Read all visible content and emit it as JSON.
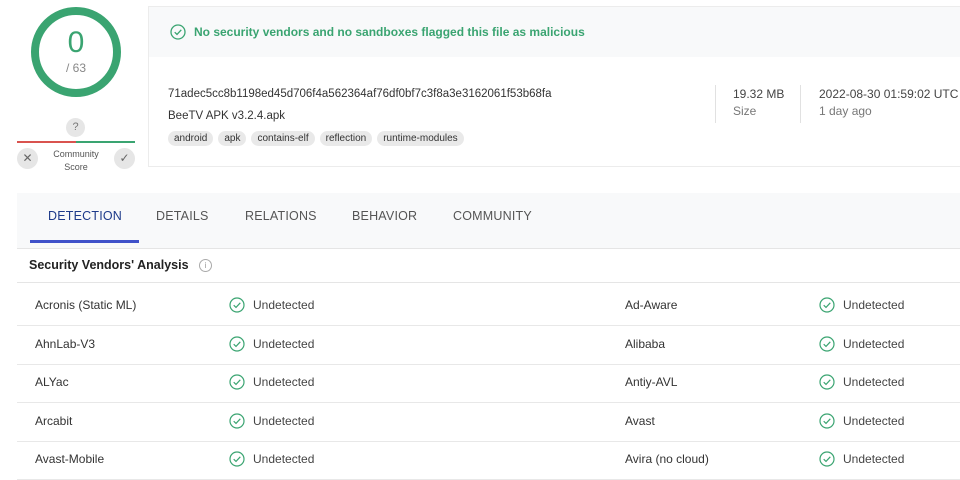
{
  "score": {
    "detections": "0",
    "total": "/ 63",
    "fraction": 0.0,
    "color": "#3aa471"
  },
  "community": {
    "question": "?",
    "label_line1": "Community",
    "label_line2": "Score",
    "down": "✕",
    "up": "✓"
  },
  "file": {
    "banner": "No security vendors and no sandboxes flagged this file as malicious",
    "hash": "71adec5cc8b1198ed45d706f4a562364af76df0bf7c3f8a3e3162061f53b68fa",
    "name": "BeeTV APK v3.2.4.apk",
    "tags": [
      "android",
      "apk",
      "contains-elf",
      "reflection",
      "runtime-modules"
    ],
    "size_value": "19.32 MB",
    "size_label": "Size",
    "date_value": "2022-08-30 01:59:02 UTC",
    "date_label": "1 day ago"
  },
  "tabs": [
    "DETECTION",
    "DETAILS",
    "RELATIONS",
    "BEHAVIOR",
    "COMMUNITY"
  ],
  "section": {
    "title": "Security Vendors' Analysis",
    "info": "i"
  },
  "vendors": [
    {
      "left": "Acronis (Static ML)",
      "left_result": "Undetected",
      "right": "Ad-Aware",
      "right_result": "Undetected"
    },
    {
      "left": "AhnLab-V3",
      "left_result": "Undetected",
      "right": "Alibaba",
      "right_result": "Undetected"
    },
    {
      "left": "ALYac",
      "left_result": "Undetected",
      "right": "Antiy-AVL",
      "right_result": "Undetected"
    },
    {
      "left": "Arcabit",
      "left_result": "Undetected",
      "right": "Avast",
      "right_result": "Undetected"
    },
    {
      "left": "Avast-Mobile",
      "left_result": "Undetected",
      "right": "Avira (no cloud)",
      "right_result": "Undetected"
    }
  ],
  "colors": {
    "green": "#3aa471",
    "red": "#d9534f",
    "tab_accent": "#3f51c9"
  },
  "icons": {
    "check": "check-circle-icon",
    "info": "info-icon",
    "question": "question-icon"
  }
}
